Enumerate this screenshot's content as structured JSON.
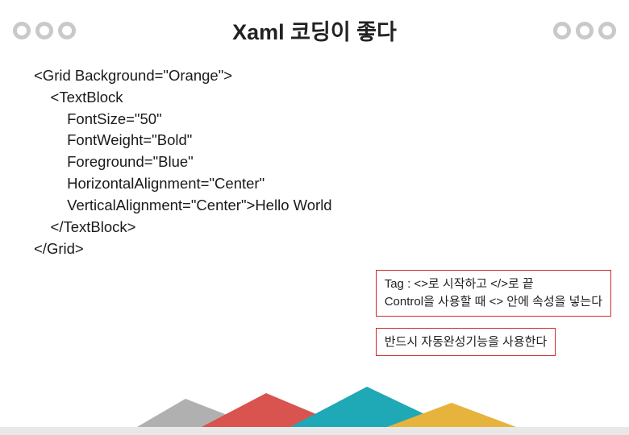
{
  "header": {
    "title": "Xaml 코딩이 좋다"
  },
  "code": {
    "l1": "<Grid Background=\"Orange\">",
    "l2": "    <TextBlock",
    "l3": "        FontSize=\"50\"",
    "l4": "        FontWeight=\"Bold\"",
    "l5": "        Foreground=\"Blue\"",
    "l6": "        HorizontalAlignment=\"Center\"",
    "l7": "        VerticalAlignment=\"Center\">Hello World",
    "l8": "    </TextBlock>",
    "l9": "</Grid>"
  },
  "notes": {
    "box1_line1": "Tag : <>로 시작하고 </>로 끝",
    "box1_line2": "Control을 사용할 때 <> 안에 속성을 넣는다",
    "box2": "반드시 자동완성기능을 사용한다"
  }
}
